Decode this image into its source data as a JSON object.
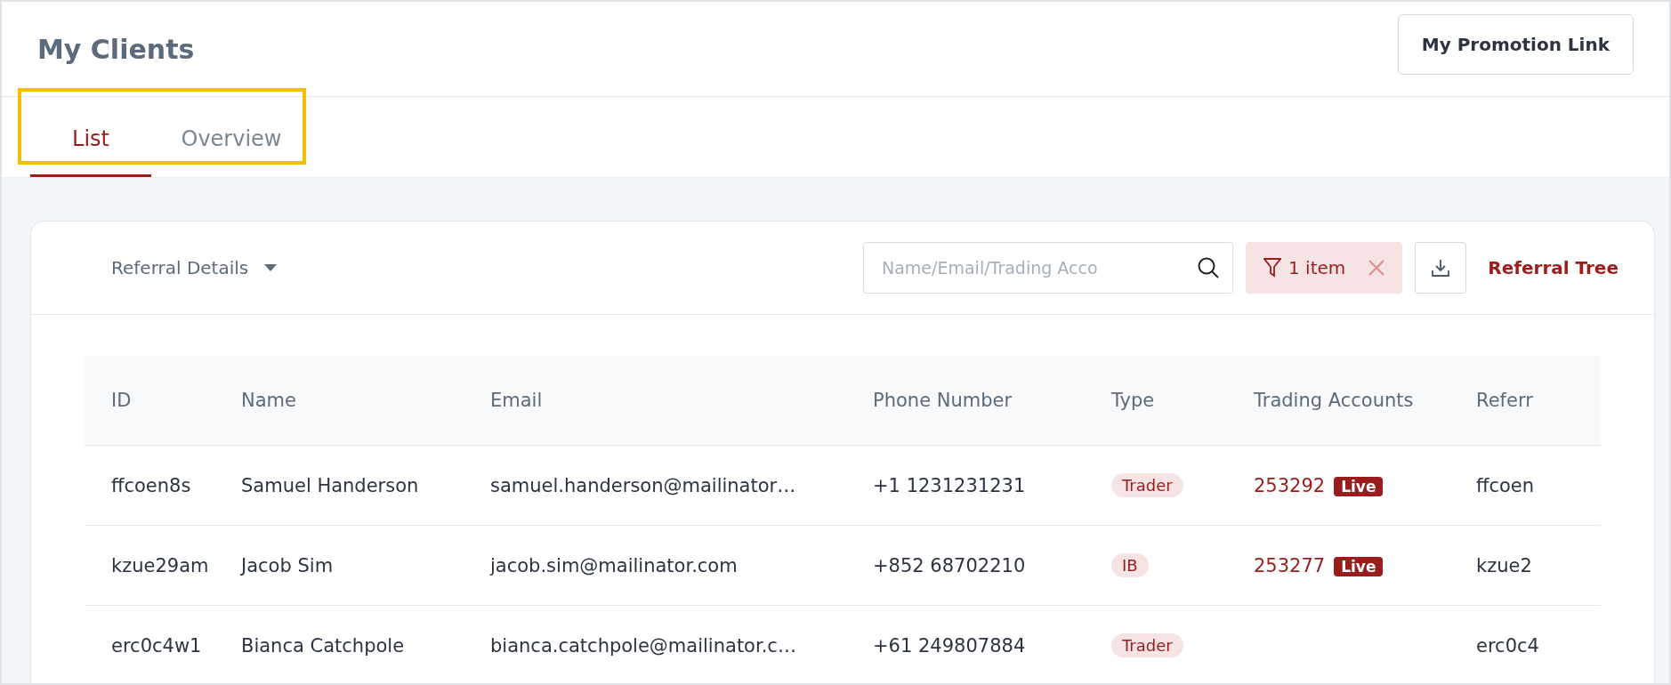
{
  "header": {
    "title": "My Clients",
    "promotion_button": "My Promotion Link"
  },
  "tabs": [
    {
      "label": "List",
      "selected": true
    },
    {
      "label": "Overview",
      "selected": false
    }
  ],
  "toolbar": {
    "view_select": "Referral Details",
    "search": {
      "placeholder": "Name/Email/Trading Acco"
    },
    "filter_chip": "1 item",
    "referral_tree_link": "Referral Tree"
  },
  "table": {
    "columns": [
      "ID",
      "Name",
      "Email",
      "Phone Number",
      "Type",
      "Trading Accounts",
      "Referr"
    ],
    "rows": [
      {
        "id": "ffcoen8s",
        "name": "Samuel Handerson",
        "email": "samuel.handerson@mailinator…",
        "phone": "+1 1231231231",
        "type": "Trader",
        "accounts": [
          {
            "number": "253292",
            "status": "Live"
          }
        ],
        "column_7": "ffcoen"
      },
      {
        "id": "kzue29am",
        "name": "Jacob Sim",
        "email": "jacob.sim@mailinator.com",
        "phone": "+852 68702210",
        "type": "IB",
        "accounts": [
          {
            "number": "253277",
            "status": "Live"
          }
        ],
        "column_7": "kzue2"
      },
      {
        "id": "erc0c4w1",
        "name": "Bianca Catchpole",
        "email": "bianca.catchpole@mailinator.c…",
        "phone": "+61 249807884",
        "type": "Trader",
        "accounts": [],
        "column_7": "erc0c4"
      }
    ]
  }
}
